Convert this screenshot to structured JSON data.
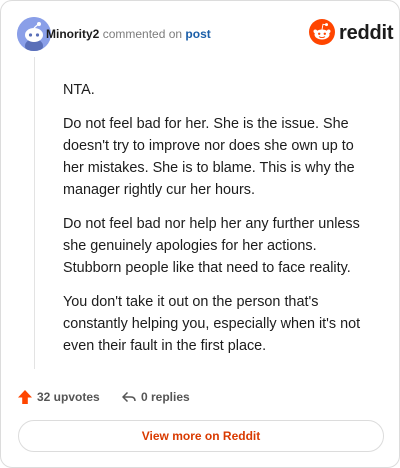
{
  "comment": {
    "author": "Minority2",
    "action": "commented on",
    "post_link": "post",
    "paragraphs": [
      "NTA.",
      "Do not feel bad for her. She is the issue. She doesn't try to improve nor does she own up to her mistakes. She is to blame. This is why the manager rightly cur her hours.",
      "Do not feel bad nor help her any further unless she genuinely apologies for her actions. Stubborn people like that need to face reality.",
      "You don't take it out on the person that's constantly helping you, especially when it's not even their fault in the first place."
    ]
  },
  "logo": {
    "text": "reddit"
  },
  "stats": {
    "upvotes": "32 upvotes",
    "replies": "0 replies"
  },
  "view_more_label": "View more on Reddit",
  "colors": {
    "brand": "#ff4500",
    "upvote": "#ff4500",
    "link": "#1a5ea8",
    "view_more": "#d93a00",
    "avatar": "#8a9fe8"
  },
  "icons": {
    "avatar": "snoo-avatar-icon",
    "logo": "reddit-snoo-icon",
    "upvote": "upvote-arrow-icon",
    "reply": "reply-arrow-icon"
  }
}
